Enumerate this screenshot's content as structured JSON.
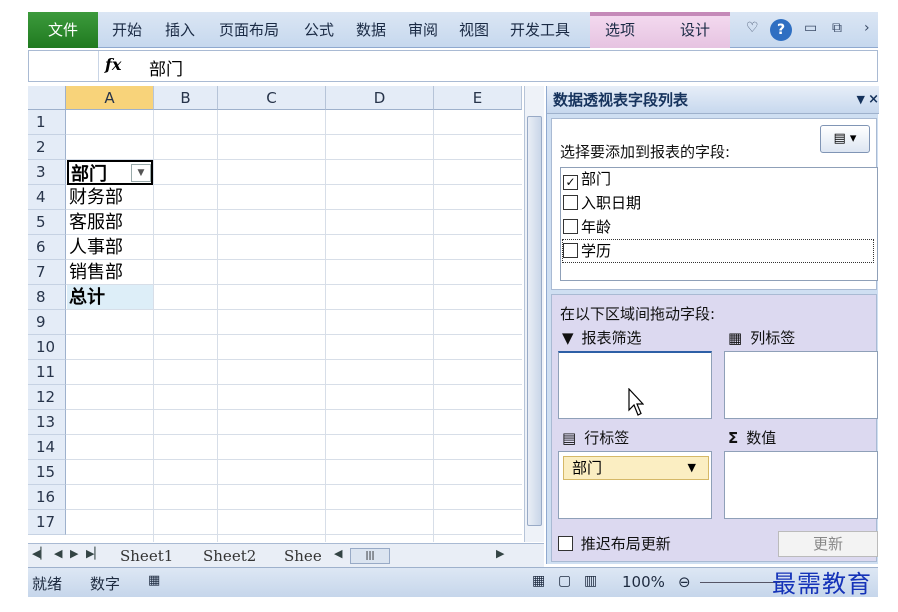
{
  "ribbon": {
    "file": "文件",
    "tabs": [
      "开始",
      "插入",
      "页面布局",
      "公式",
      "数据",
      "审阅",
      "视图",
      "开发工具",
      "选项",
      "设计"
    ],
    "help": "?"
  },
  "formula": {
    "fx": "fx",
    "content": "部门"
  },
  "grid": {
    "columns": [
      "A",
      "B",
      "C",
      "D",
      "E"
    ],
    "rows": [
      "1",
      "2",
      "3",
      "4",
      "5",
      "6",
      "7",
      "8",
      "9",
      "10",
      "11",
      "12",
      "13",
      "14",
      "15",
      "16",
      "17"
    ],
    "cells": {
      "a3": "部门",
      "a4": "财务部",
      "a5": "客服部",
      "a6": "人事部",
      "a7": "销售部",
      "a8": "总计"
    }
  },
  "sheets": {
    "tab1": "Sheet1",
    "tab2": "Sheet2",
    "tab3": "Shee"
  },
  "status": {
    "ready": "就绪",
    "mode": "数字",
    "zoom": "100%"
  },
  "pane": {
    "title": "数据透视表字段列表",
    "choose_label": "选择要添加到报表的字段:",
    "fields": [
      {
        "label": "部门",
        "checked": true
      },
      {
        "label": "入职日期",
        "checked": false
      },
      {
        "label": "年龄",
        "checked": false
      },
      {
        "label": "学历",
        "checked": false
      }
    ],
    "drag_label": "在以下区域间拖动字段:",
    "areas": {
      "filter": "报表筛选",
      "columns": "列标签",
      "rows": "行标签",
      "values": "数值"
    },
    "row_chip": "部门",
    "defer": "推迟布局更新",
    "update": "更新"
  },
  "watermark": "最需教育",
  "colors": {
    "file_tab": "#2e8b2e",
    "context_tab": "#e6c3e1",
    "pane_bg": "#cfdff2",
    "chip": "#fbeec2"
  }
}
